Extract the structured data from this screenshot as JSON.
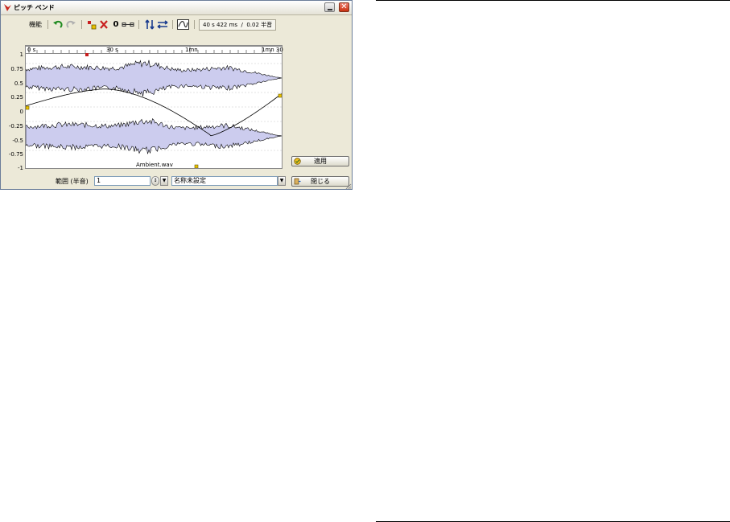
{
  "window": {
    "title": "ピッチ ベンド",
    "close_glyph": "✕"
  },
  "toolbar": {
    "function_label": "機能",
    "point_value": "0",
    "time_readout": "40 s 422 ms",
    "separator": "/",
    "pitch_readout": "0.02 半音"
  },
  "ruler": {
    "labels": [
      "0 s",
      "30 s",
      "1mn",
      "1mn 30"
    ]
  },
  "y_axis": {
    "labels": [
      "1",
      "0.75",
      "0.5",
      "0.25",
      "0",
      "-0.25",
      "-0.5",
      "-0.75",
      "-1"
    ]
  },
  "waveform": {
    "filename": "Ambient.wav",
    "fill_color": "#ccccee"
  },
  "buttons": {
    "apply_label": "適用",
    "close_label": "閉じる"
  },
  "bottom": {
    "range_label": "範囲 (半音)",
    "range_value": "1",
    "preset_value": "名称未設定"
  },
  "icons": {
    "undo": "undo-icon",
    "redo": "redo-icon",
    "add_point": "add-point-icon",
    "delete_point": "delete-icon",
    "link": "link-icon",
    "flip_vertical": "flip-vertical-icon",
    "swap": "swap-icon",
    "curve": "curve-icon"
  }
}
